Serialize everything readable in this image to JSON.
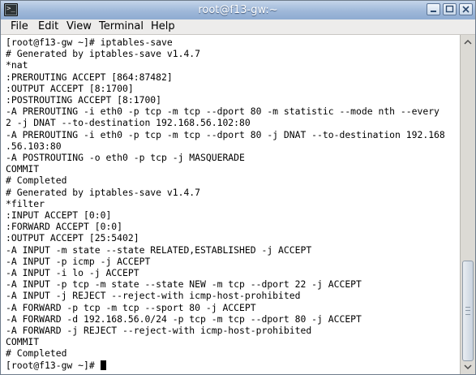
{
  "window": {
    "title": "root@f13-gw:~",
    "icon": "terminal-icon",
    "controls": [
      "minimize-icon",
      "maximize-icon",
      "close-icon"
    ]
  },
  "menu": {
    "file": "File",
    "edit": "Edit",
    "view": "View",
    "terminal": "Terminal",
    "help": "Help"
  },
  "terminal": {
    "lines": [
      "[root@f13-gw ~]# iptables-save",
      "# Generated by iptables-save v1.4.7",
      "*nat",
      ":PREROUTING ACCEPT [864:87482]",
      ":OUTPUT ACCEPT [8:1700]",
      ":POSTROUTING ACCEPT [8:1700]",
      "-A PREROUTING -i eth0 -p tcp -m tcp --dport 80 -m statistic --mode nth --every",
      "2 -j DNAT --to-destination 192.168.56.102:80",
      "-A PREROUTING -i eth0 -p tcp -m tcp --dport 80 -j DNAT --to-destination 192.168",
      ".56.103:80",
      "-A POSTROUTING -o eth0 -p tcp -j MASQUERADE",
      "COMMIT",
      "# Completed",
      "# Generated by iptables-save v1.4.7",
      "*filter",
      ":INPUT ACCEPT [0:0]",
      ":FORWARD ACCEPT [0:0]",
      ":OUTPUT ACCEPT [25:5402]",
      "-A INPUT -m state --state RELATED,ESTABLISHED -j ACCEPT",
      "-A INPUT -p icmp -j ACCEPT",
      "-A INPUT -i lo -j ACCEPT",
      "-A INPUT -p tcp -m state --state NEW -m tcp --dport 22 -j ACCEPT",
      "-A INPUT -j REJECT --reject-with icmp-host-prohibited",
      "-A FORWARD -p tcp -m tcp --sport 80 -j ACCEPT",
      "-A FORWARD -d 192.168.56.0/24 -p tcp -m tcp --dport 80 -j ACCEPT",
      "-A FORWARD -j REJECT --reject-with icmp-host-prohibited",
      "COMMIT",
      "# Completed"
    ],
    "prompt": "[root@f13-gw ~]# "
  }
}
